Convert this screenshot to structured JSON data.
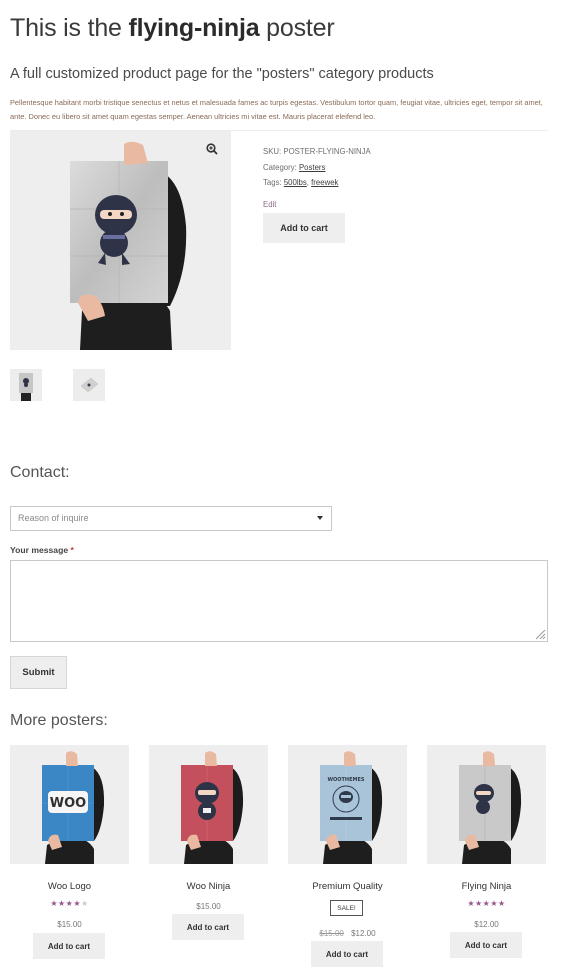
{
  "page": {
    "title_prefix": "This is the",
    "title_bold": "flying-ninja",
    "title_suffix": "poster",
    "subtitle": "A full customized product page for the \"posters\" category products",
    "intro": "Pellentesque habitant morbi tristique senectus et netus et malesuada fames ac turpis egestas. Vestibulum tortor quam, feugiat vitae, ultricies eget, tempor sit amet, ante. Donec eu libero sit amet quam egestas semper. Aenean ultricies mi vitae est. Mauris placerat eleifend leo."
  },
  "product": {
    "sku_label": "SKU:",
    "sku": "POSTER-FLYING-NINJA",
    "category_label": "Category:",
    "category": "Posters",
    "tags_label": "Tags:",
    "tag1": "500lbs",
    "tag_sep": ",",
    "tag2": "freewek",
    "edit": "Edit",
    "add_to_cart": "Add to cart",
    "zoom_icon": "magnifier-plus-icon"
  },
  "contact": {
    "heading": "Contact:",
    "select_placeholder": "Reason of inquire",
    "message_label": "Your message",
    "required_mark": "*",
    "submit": "Submit"
  },
  "more": {
    "heading": "More posters:",
    "items": [
      {
        "title": "Woo Logo",
        "price": "$15.00",
        "rating": 4,
        "cart": "Add to cart",
        "poster_color": "#3b86c4"
      },
      {
        "title": "Woo Ninja",
        "price": "$15.00",
        "cart": "Add to cart",
        "poster_color": "#c4505d"
      },
      {
        "title": "Premium Quality",
        "sale": "SALE!",
        "old_price": "$15.00",
        "price": "$12.00",
        "cart": "Add to cart",
        "poster_color": "#a9c3d8",
        "poster_text": "WOOTHEMES"
      },
      {
        "title": "Flying Ninja",
        "price": "$12.00",
        "rating": 5,
        "cart": "Add to cart",
        "poster_color": "#c9c9c9"
      }
    ]
  },
  "colors": {
    "accent": "#96588a",
    "button_bg": "#eeeeee",
    "text": "#43454b"
  }
}
